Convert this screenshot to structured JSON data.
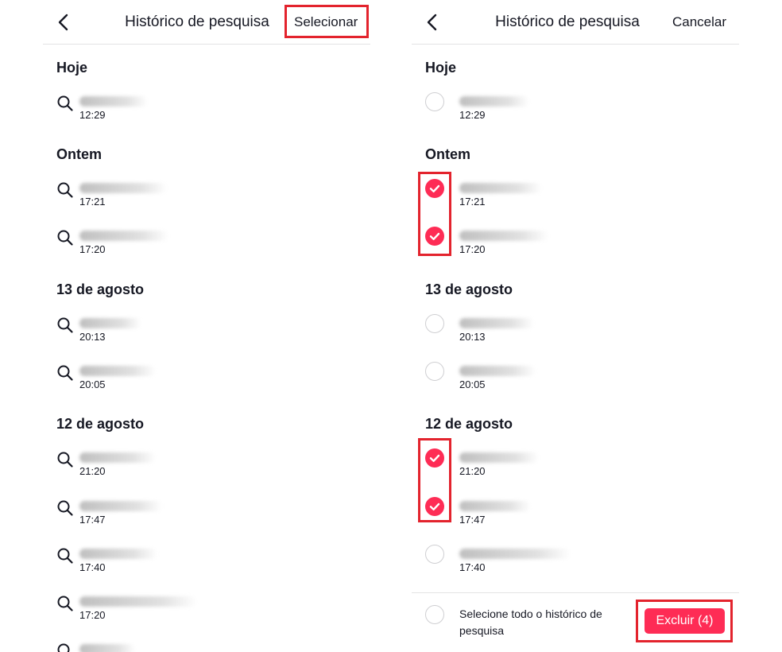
{
  "left_panel": {
    "title": "Histórico de pesquisa",
    "action_label": "Selecionar",
    "sections": [
      {
        "heading": "Hoje",
        "items": [
          {
            "time": "12:29"
          }
        ]
      },
      {
        "heading": "Ontem",
        "items": [
          {
            "time": "17:21"
          },
          {
            "time": "17:20"
          }
        ]
      },
      {
        "heading": "13 de agosto",
        "items": [
          {
            "time": "20:13"
          },
          {
            "time": "20:05"
          }
        ]
      },
      {
        "heading": "12 de agosto",
        "items": [
          {
            "time": "21:20"
          },
          {
            "time": "17:47"
          },
          {
            "time": "17:40"
          },
          {
            "time": "17:20"
          }
        ]
      }
    ]
  },
  "right_panel": {
    "title": "Histórico de pesquisa",
    "action_label": "Cancelar",
    "sections": [
      {
        "heading": "Hoje",
        "items": [
          {
            "time": "12:29",
            "selected": false
          }
        ]
      },
      {
        "heading": "Ontem",
        "items": [
          {
            "time": "17:21",
            "selected": true
          },
          {
            "time": "17:20",
            "selected": true
          }
        ]
      },
      {
        "heading": "13 de agosto",
        "items": [
          {
            "time": "20:13",
            "selected": false
          },
          {
            "time": "20:05",
            "selected": false
          }
        ]
      },
      {
        "heading": "12 de agosto",
        "items": [
          {
            "time": "21:20",
            "selected": true
          },
          {
            "time": "17:47",
            "selected": true
          },
          {
            "time": "17:40",
            "selected": false
          }
        ]
      }
    ],
    "footer": {
      "select_all_label": "Selecione todo o histórico de pesquisa",
      "select_all_checked": false,
      "delete_label": "Excluir (4)"
    }
  },
  "colors": {
    "accent": "#fe2c55",
    "highlight": "#e3232d",
    "text": "#161823",
    "divider": "#e3e3e4"
  },
  "icons": {
    "back": "chevron-left-icon",
    "search": "search-icon",
    "check": "check-icon"
  }
}
